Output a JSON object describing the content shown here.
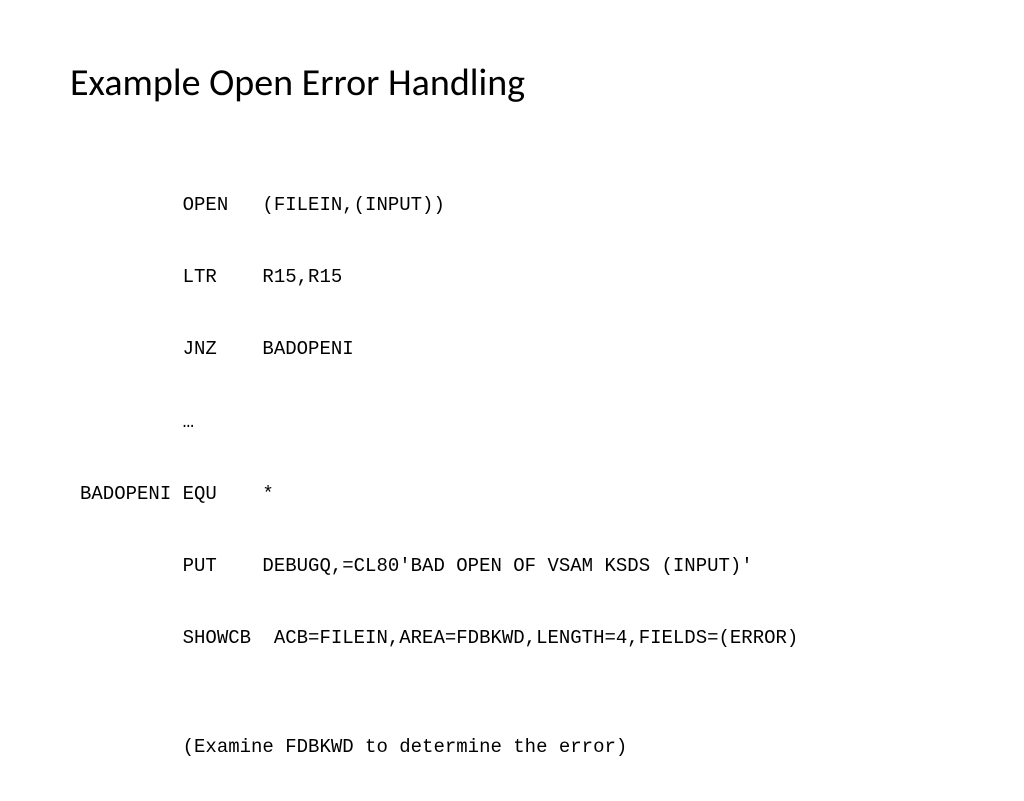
{
  "title": "Example Open Error Handling",
  "code": {
    "line1": "         OPEN   (FILEIN,(INPUT))",
    "line2": "         LTR    R15,R15",
    "line3": "         JNZ    BADOPENI",
    "line4": "         …",
    "line5": "BADOPENI EQU    *",
    "line6": "         PUT    DEBUGQ,=CL80'BAD OPEN OF VSAM KSDS (INPUT)'",
    "line7": "         SHOWCB  ACB=FILEIN,AREA=FDBKWD,LENGTH=4,FIELDS=(ERROR)",
    "line8": "",
    "line9": "         (Examine FDBKWD to determine the error)"
  }
}
